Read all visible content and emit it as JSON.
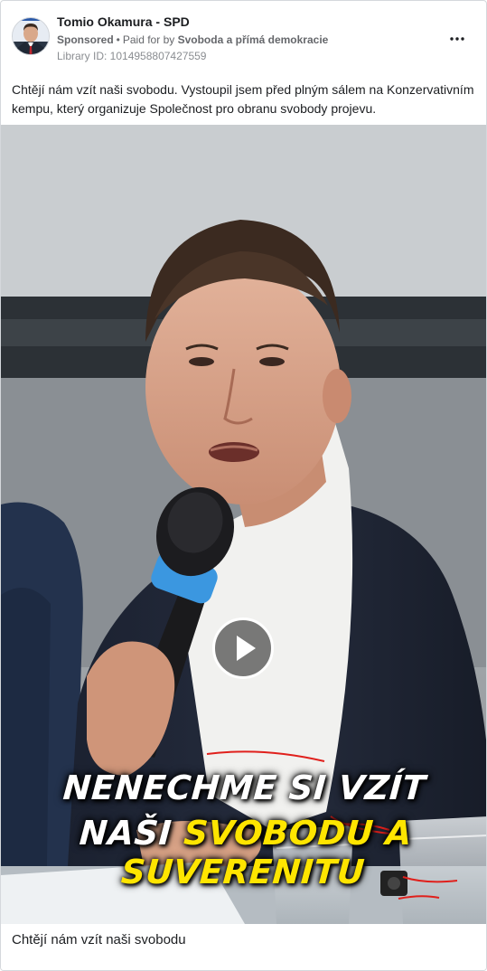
{
  "post": {
    "author": "Tomio Okamura - SPD",
    "sponsored_label": "Sponsored",
    "paid_for_prefix": "Paid for by",
    "paid_for_by": "Svoboda a přímá demokracie",
    "library_id": "Library ID: 1014958807427559",
    "caption": "Chtějí nám vzít naši svobodu. Vystoupil jsem před plným sálem na Konzervativním kempu, který organizuje Společnost pro obranu svobody projevu.",
    "more_icon": "more-horizontal-icon"
  },
  "video": {
    "overlay_line1": "NENECHME SI VZÍT",
    "overlay_line2_white": "NAŠI ",
    "overlay_line2_yellow": "SVOBODU A SUVERENITU",
    "play_icon": "play-icon",
    "colors": {
      "overlay_yellow": "#ffe500",
      "annotation_red": "#e0201c"
    }
  },
  "footer": {
    "headline": "Chtějí nám vzít naši svobodu"
  }
}
